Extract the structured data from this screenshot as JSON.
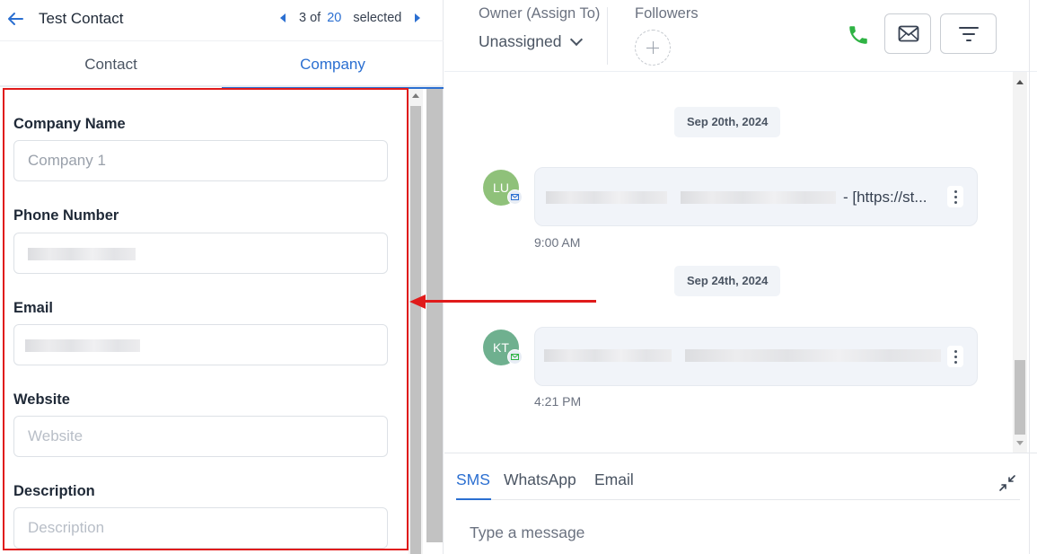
{
  "topbar": {
    "contact_name": "Test Contact",
    "pager_current": "3 of",
    "pager_total": "20",
    "pager_suffix": "selected"
  },
  "tabs": [
    {
      "label": "Contact",
      "active": false
    },
    {
      "label": "Company",
      "active": true
    }
  ],
  "form": {
    "company_name": {
      "label": "Company Name",
      "placeholder": "Company 1"
    },
    "phone_number": {
      "label": "Phone Number"
    },
    "email": {
      "label": "Email"
    },
    "website": {
      "label": "Website",
      "placeholder": "Website"
    },
    "description": {
      "label": "Description",
      "placeholder": "Description"
    }
  },
  "header": {
    "owner_label": "Owner (Assign To)",
    "owner_value": "Unassigned",
    "followers_label": "Followers"
  },
  "conversation": [
    {
      "date": "Sep 20th, 2024",
      "avatar_initials": "LU",
      "avatar_color": "#8fc17a",
      "badge_icon": "mail-icon",
      "text": "-  [https://st...",
      "time": "9:00 AM"
    },
    {
      "date": "Sep 24th, 2024",
      "avatar_initials": "KT",
      "avatar_color": "#6fb08f",
      "badge_icon": "mail-icon",
      "text": "",
      "time": "4:21 PM"
    }
  ],
  "composer": {
    "tabs": [
      {
        "label": "SMS",
        "active": true
      },
      {
        "label": "WhatsApp",
        "active": false
      },
      {
        "label": "Email",
        "active": false
      }
    ],
    "placeholder": "Type a message"
  },
  "colors": {
    "accent": "#2b6fd1",
    "annotation_red": "#e01b1b",
    "phone_green": "#2fb344"
  }
}
